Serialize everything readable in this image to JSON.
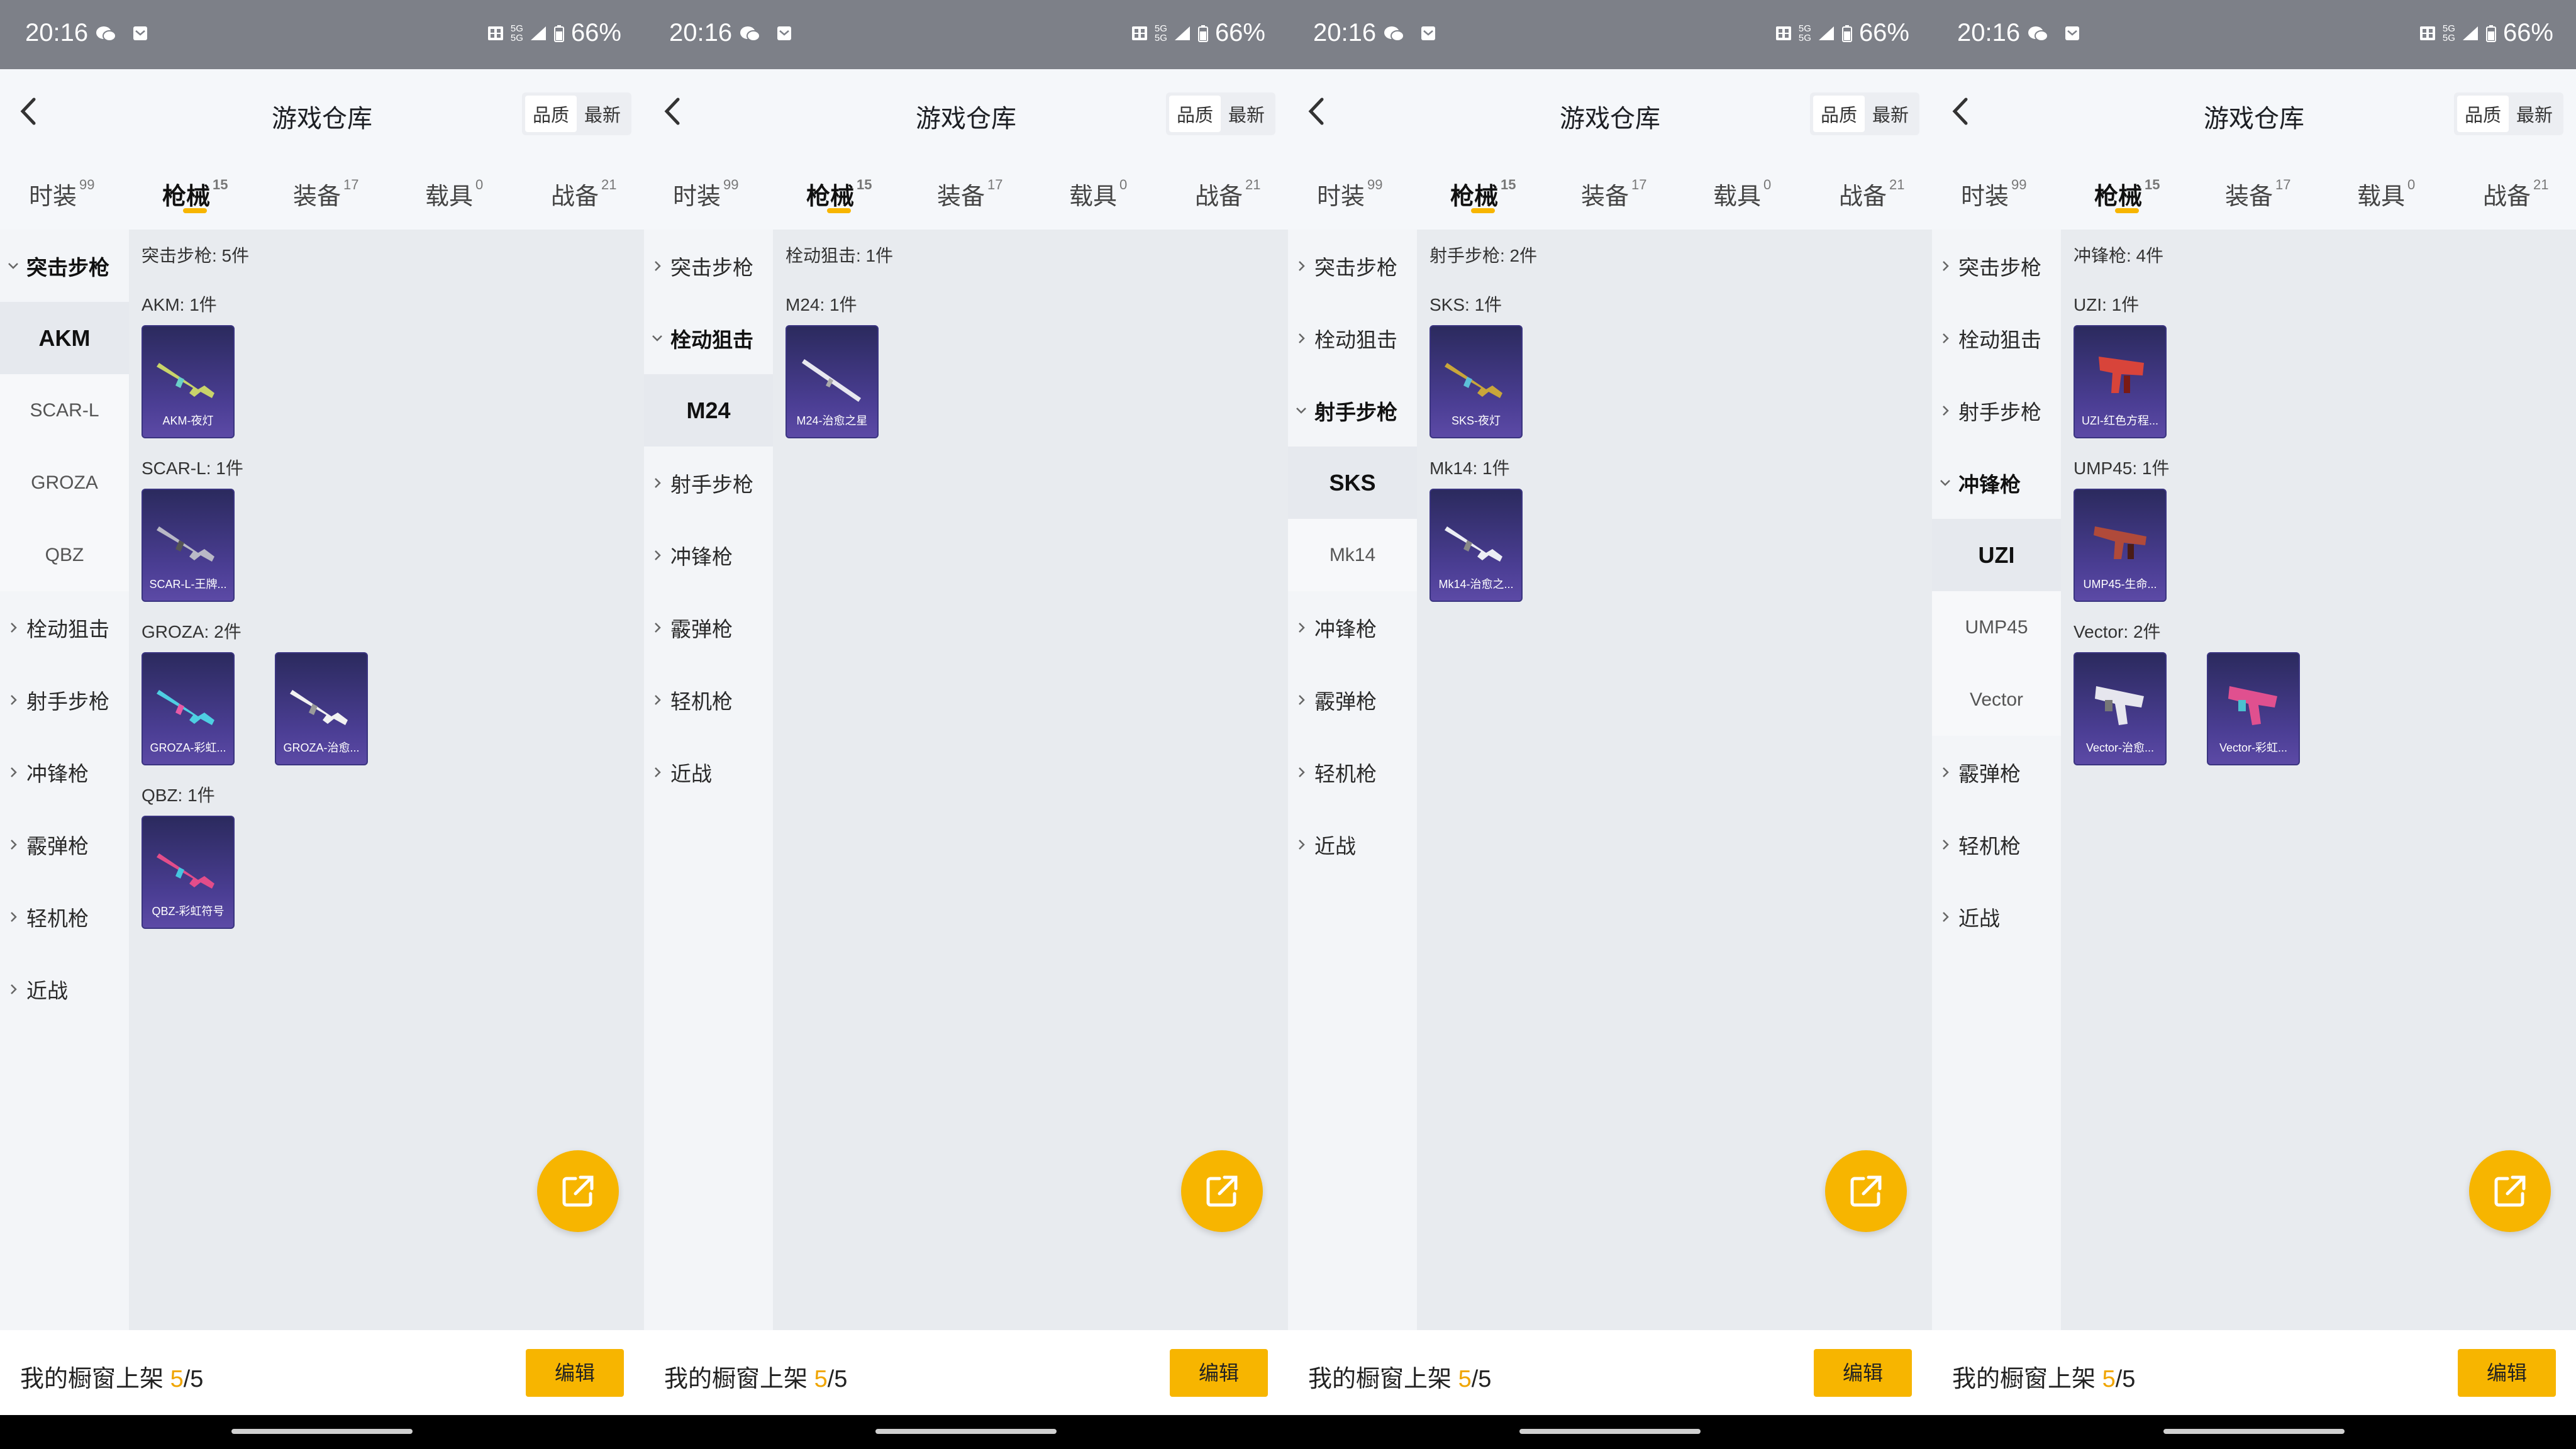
{
  "status": {
    "time": "20:16",
    "signal_top": "5G",
    "signal_bottom": "5G",
    "battery": "66%"
  },
  "header": {
    "title": "游戏仓库",
    "sort_quality": "品质",
    "sort_latest": "最新"
  },
  "tabs": [
    {
      "label": "时装",
      "count": "99"
    },
    {
      "label": "枪械",
      "count": "15"
    },
    {
      "label": "装备",
      "count": "17"
    },
    {
      "label": "载具",
      "count": "0"
    },
    {
      "label": "战备",
      "count": "21"
    }
  ],
  "categories": [
    "突击步枪",
    "栓动狙击",
    "射手步枪",
    "冲锋枪",
    "霰弹枪",
    "轻机枪",
    "近战"
  ],
  "subcategories": {
    "ar": [
      "AKM",
      "SCAR-L",
      "GROZA",
      "QBZ"
    ],
    "sr": [
      "M24"
    ],
    "dmr": [
      "SKS",
      "Mk14"
    ],
    "smg": [
      "UZI",
      "UMP45",
      "Vector"
    ]
  },
  "panels": [
    {
      "group_header": "突击步枪: 5件",
      "items": [
        {
          "label": "AKM: 1件",
          "cards": [
            "AKM-夜灯"
          ]
        },
        {
          "label": "SCAR-L: 1件",
          "cards": [
            "SCAR-L-王牌..."
          ]
        },
        {
          "label": "GROZA: 2件",
          "cards": [
            "GROZA-彩虹...",
            "GROZA-治愈..."
          ]
        },
        {
          "label": "QBZ: 1件",
          "cards": [
            "QBZ-彩虹符号"
          ]
        }
      ]
    },
    {
      "group_header": "栓动狙击: 1件",
      "items": [
        {
          "label": "M24: 1件",
          "cards": [
            "M24-治愈之星"
          ]
        }
      ]
    },
    {
      "group_header": "射手步枪: 2件",
      "items": [
        {
          "label": "SKS: 1件",
          "cards": [
            "SKS-夜灯"
          ]
        },
        {
          "label": "Mk14: 1件",
          "cards": [
            "Mk14-治愈之..."
          ]
        }
      ]
    },
    {
      "group_header": "冲锋枪: 4件",
      "items": [
        {
          "label": "UZI: 1件",
          "cards": [
            "UZI-红色方程..."
          ]
        },
        {
          "label": "UMP45: 1件",
          "cards": [
            "UMP45-生命..."
          ]
        },
        {
          "label": "Vector: 2件",
          "cards": [
            "Vector-治愈...",
            "Vector-彩虹..."
          ]
        }
      ]
    }
  ],
  "footer": {
    "prefix": "我的橱窗上架 ",
    "count": "5",
    "suffix": "/5",
    "edit": "编辑"
  },
  "colors": {
    "accent": "#f7b500",
    "card_bg": "#3d3485",
    "status_bar": "#7d8088"
  },
  "icons": [
    "back-icon",
    "wechat-icon",
    "message-icon",
    "share-icon",
    "chevron-right-icon",
    "chevron-down-icon",
    "rifle-icon"
  ]
}
